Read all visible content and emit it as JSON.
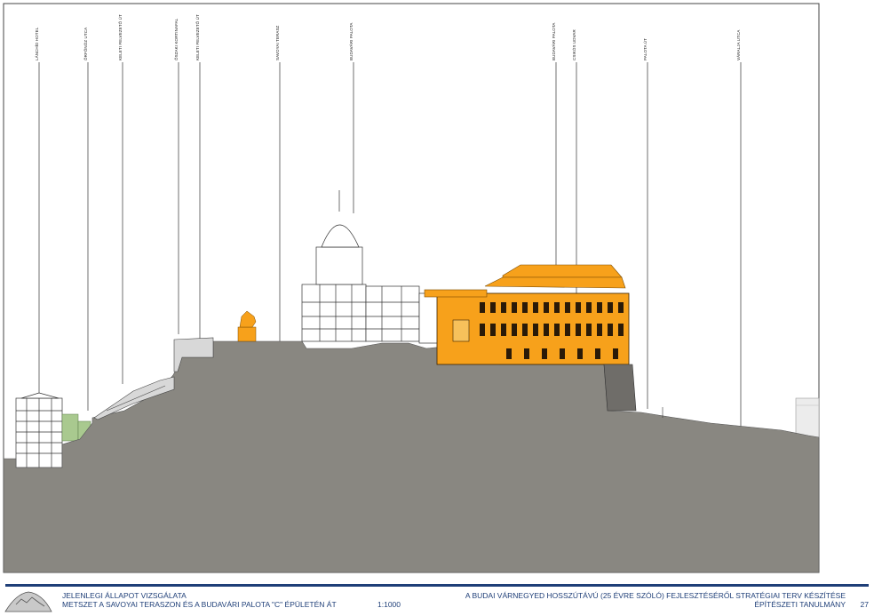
{
  "labels": [
    "LÁNCHÍD HOTEL",
    "ŐRFŐNÖZ UTCA",
    "KELETI FELVEZETŐ ÚT",
    "ŐSZAKI KORTINAFAL",
    "KELETI FELVEZETŐ ÚT",
    "SAVOYAI TERASZ",
    "BUDAVÁRI PALOTA",
    "BUDAVÁRI PALOTA",
    "CSIKÓS UDVAR",
    "PALOTA ÚT",
    "VÁRALJA UTCA"
  ],
  "footer": {
    "left_line1": "JELENLEGI ÁLLAPOT VIZSGÁLATA",
    "left_line2": "METSZET A SAVOYAI TERASZON ÉS A BUDAVÁRI PALOTA \"C\" ÉPÜLETÉN ÁT",
    "scale": "1:1000",
    "right_line1": "A BUDAI VÁRNEGYED HOSSZÚTÁVÚ (25 ÉVRE SZÓLÓ) FEJLESZTÉSÉRŐL STRATÉGIAI TERV KÉSZÍTÉSE",
    "right_line2": "ÉPÍTÉSZETI TANULMÁNY",
    "page": "27"
  },
  "colors": {
    "terrain": "#898781",
    "palace": "#f7a11b",
    "footer": "#1f3f78",
    "vegetation": "#a9c98f"
  },
  "icons": [
    "castle-hill-logo-icon"
  ]
}
